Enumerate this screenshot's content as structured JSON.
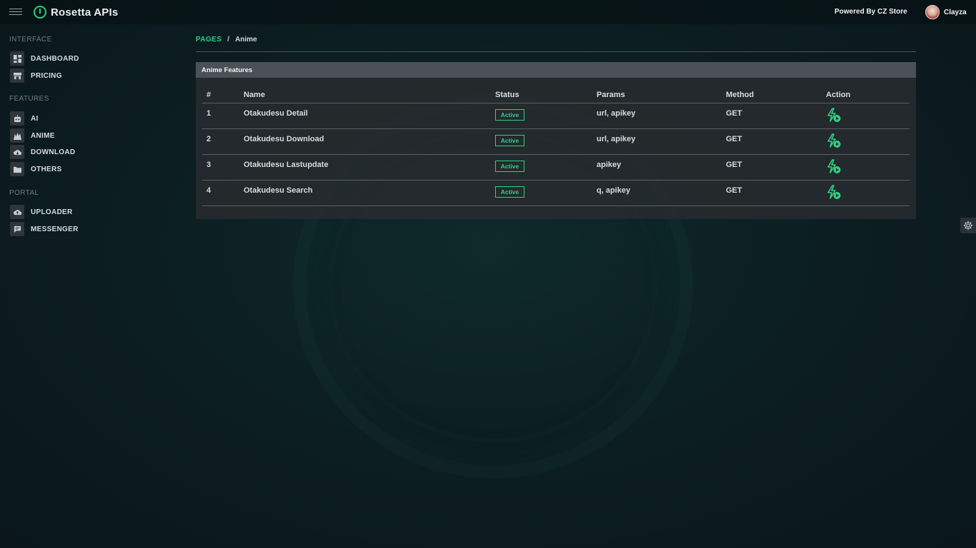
{
  "app": {
    "title": "Rosetta APIs",
    "accent_color": "#2ed183"
  },
  "header": {
    "powered_by": "Powered By CZ Store",
    "user_name": "Clayza"
  },
  "sidebar": {
    "sections": [
      {
        "label": "INTERFACE",
        "items": [
          {
            "label": "DASHBOARD",
            "icon": "dashboard-icon"
          },
          {
            "label": "PRICING",
            "icon": "store-icon"
          }
        ]
      },
      {
        "label": "FEATURES",
        "items": [
          {
            "label": "AI",
            "icon": "robot-icon"
          },
          {
            "label": "ANIME",
            "icon": "anime-icon"
          },
          {
            "label": "DOWNLOAD",
            "icon": "cloud-download-icon"
          },
          {
            "label": "OTHERS",
            "icon": "folder-icon"
          }
        ]
      },
      {
        "label": "PORTAL",
        "items": [
          {
            "label": "UPLOADER",
            "icon": "cloud-upload-icon"
          },
          {
            "label": "MESSENGER",
            "icon": "chat-icon"
          }
        ]
      }
    ]
  },
  "breadcrumb": {
    "root": "PAGES",
    "separator": "/",
    "current": "Anime"
  },
  "card": {
    "title": "Anime Features",
    "columns": [
      "#",
      "Name",
      "Status",
      "Params",
      "Method",
      "Action"
    ],
    "rows": [
      {
        "idx": "1",
        "name": "Otakudesu Detail",
        "status": "Active",
        "params": "url, apikey",
        "method": "GET"
      },
      {
        "idx": "2",
        "name": "Otakudesu Download",
        "status": "Active",
        "params": "url, apikey",
        "method": "GET"
      },
      {
        "idx": "3",
        "name": "Otakudesu Lastupdate",
        "status": "Active",
        "params": "apikey",
        "method": "GET"
      },
      {
        "idx": "4",
        "name": "Otakudesu Search",
        "status": "Active",
        "params": "q, apikey",
        "method": "GET"
      }
    ],
    "action_icon": "bolt-play-icon"
  },
  "settings": {
    "icon": "gear-icon"
  }
}
